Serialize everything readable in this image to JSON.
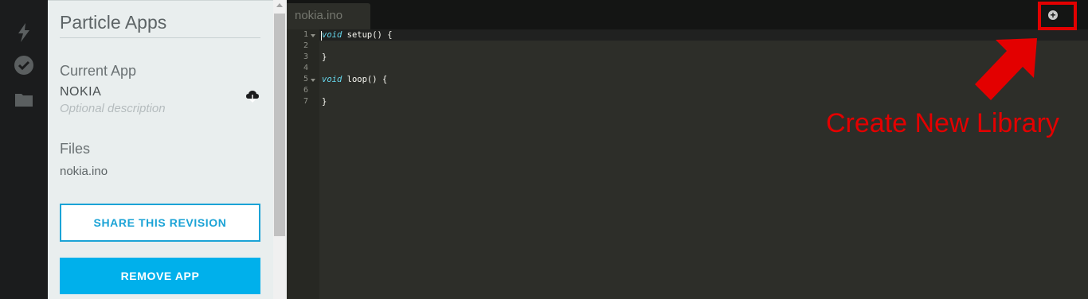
{
  "sidebar": {
    "icons": [
      "flash-icon",
      "verify-check-icon",
      "folder-icon"
    ]
  },
  "panel": {
    "title": "Particle Apps",
    "current_app_label": "Current App",
    "app_name": "NOKIA",
    "app_description_placeholder": "Optional description",
    "files_label": "Files",
    "files": [
      "nokia.ino"
    ],
    "share_button": "SHARE THIS REVISION",
    "remove_button": "REMOVE APP"
  },
  "editor": {
    "tab_name": "nokia.ino",
    "add_button_icon": "plus-circle-icon",
    "line_numbers": [
      "1",
      "2",
      "3",
      "4",
      "5",
      "6",
      "7"
    ],
    "code": [
      {
        "keyword": "void",
        "rest": " setup() {"
      },
      {
        "keyword": "",
        "rest": ""
      },
      {
        "keyword": "",
        "rest": "}"
      },
      {
        "keyword": "",
        "rest": ""
      },
      {
        "keyword": "void",
        "rest": " loop() {"
      },
      {
        "keyword": "",
        "rest": ""
      },
      {
        "keyword": "",
        "rest": "}"
      }
    ]
  },
  "annotation": {
    "label": "Create New Library",
    "color": "#e30000"
  },
  "colors": {
    "accent": "#00b0eb",
    "editor_bg": "#2d2e29",
    "keyword": "#66d9ef"
  }
}
